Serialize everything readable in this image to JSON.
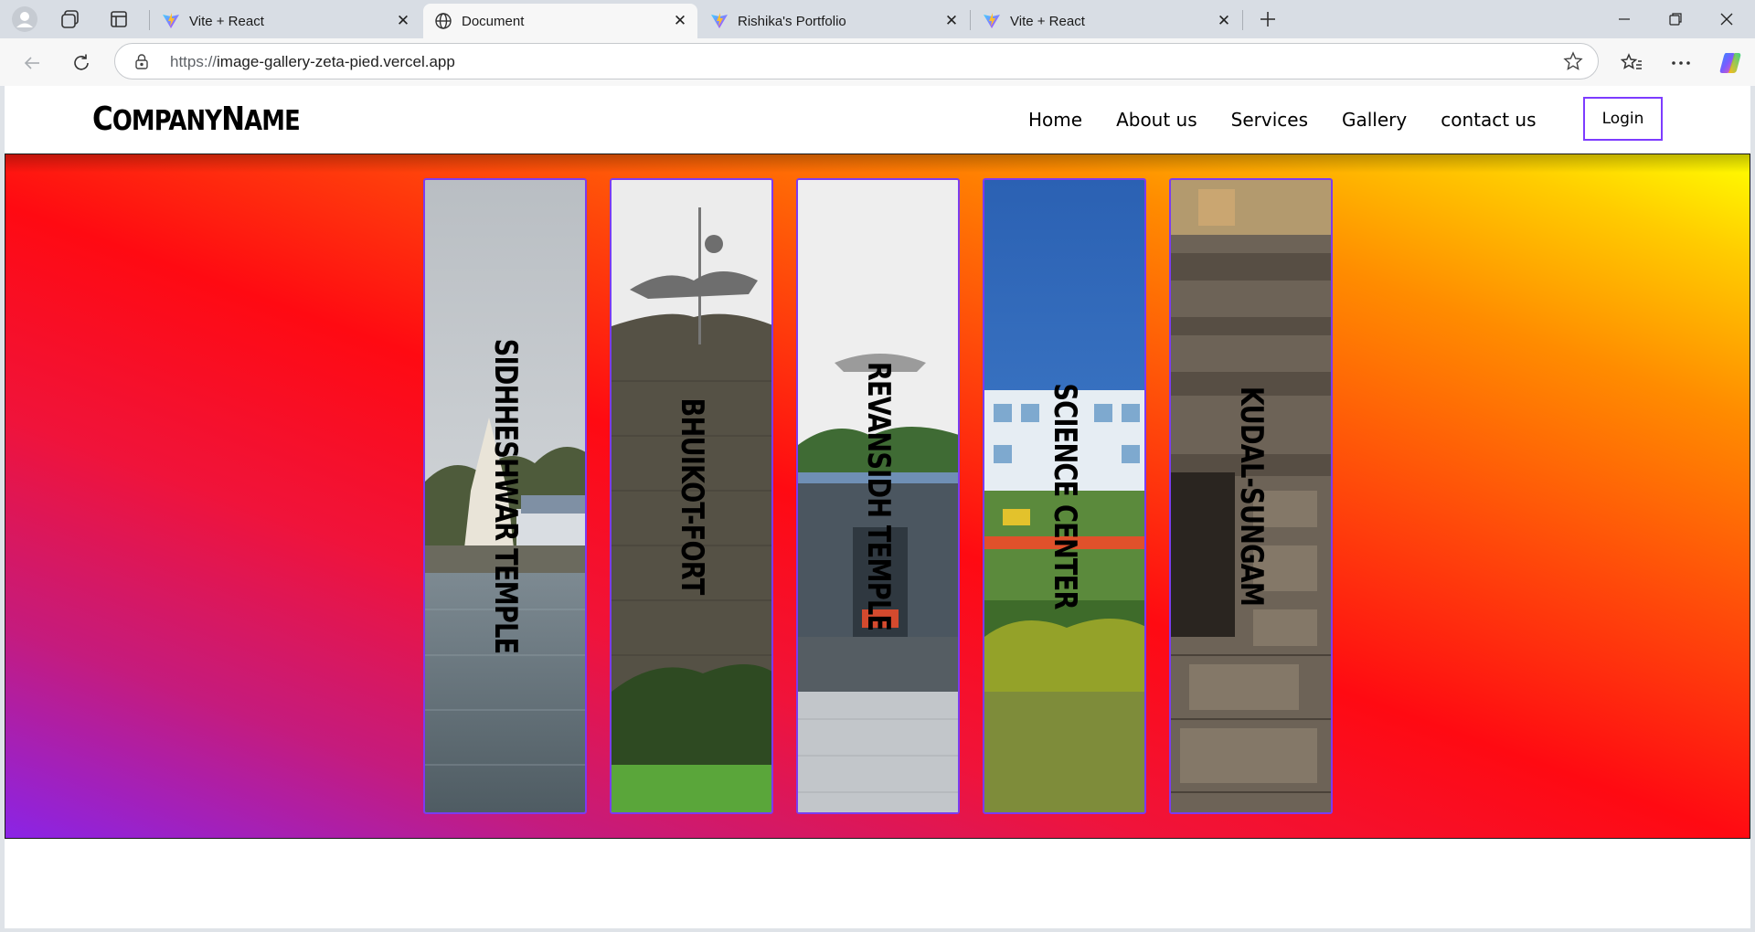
{
  "browser": {
    "tabs": [
      {
        "title": "Vite + React",
        "active": false
      },
      {
        "title": "Document",
        "active": true
      },
      {
        "title": "Rishika's Portfolio",
        "active": false
      },
      {
        "title": "Vite + React",
        "active": false
      }
    ],
    "url_scheme": "https://",
    "url_host": "image-gallery-zeta-pied.vercel.app"
  },
  "site": {
    "logo": {
      "part1_big": "C",
      "part1_small": "OMPANY",
      "part2_big": "N",
      "part2_small": "AME"
    },
    "nav": [
      "Home",
      "About us",
      "Services",
      "Gallery",
      "contact us"
    ],
    "login_label": "Login"
  },
  "gallery": [
    {
      "label": "SIDHHESHWAR TEMPLE",
      "scene": "temple-lake"
    },
    {
      "label": "BHUIKOT-FORT",
      "scene": "fort"
    },
    {
      "label": "REVANSIDH TEMPLE",
      "scene": "temple-gate"
    },
    {
      "label": "SCIENCE CENTER",
      "scene": "science-center"
    },
    {
      "label": "KUDAL-SUNGAM",
      "scene": "stone-carving"
    }
  ],
  "colors": {
    "accent": "#7b3cf0",
    "login_border": "#7d3cff"
  }
}
